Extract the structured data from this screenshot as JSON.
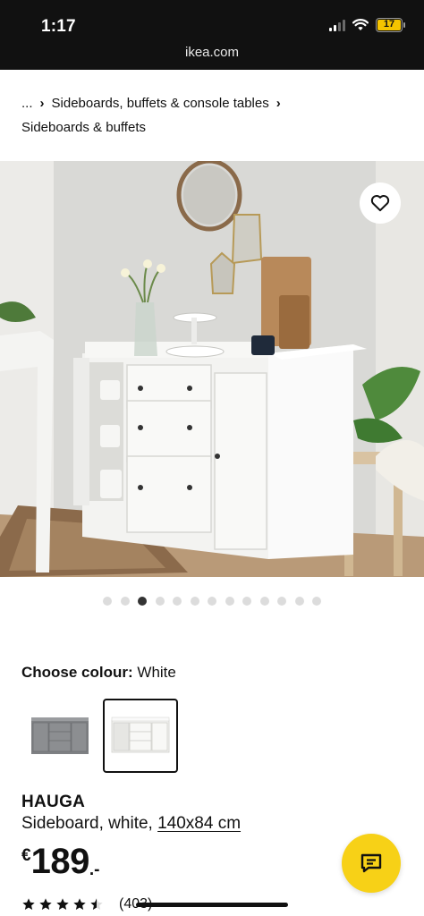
{
  "status_bar": {
    "time": "1:17",
    "battery_level": "17",
    "icons": [
      "signal-icon",
      "wifi-icon",
      "battery-icon"
    ]
  },
  "browser": {
    "url": "ikea.com"
  },
  "breadcrumb": {
    "ellipsis": "...",
    "category": "Sideboards, buffets & console tables",
    "subcategory": "Sideboards & buffets"
  },
  "gallery": {
    "image_count": 13,
    "active_index": 2,
    "favourite_icon": "heart-outline-icon"
  },
  "colour": {
    "label": "Choose colour:",
    "selected": "White",
    "options": [
      {
        "name": "Grey",
        "color": "#7f8184"
      },
      {
        "name": "White",
        "color": "#f2f2f0"
      }
    ]
  },
  "product": {
    "name": "HAUGA",
    "description": "Sideboard, white,",
    "dimensions": "140x84 cm",
    "currency": "€",
    "price": "189",
    "price_suffix": ".-",
    "rating": 4.5,
    "review_count": "(403)"
  },
  "chat": {
    "icon": "chat-bubble-icon",
    "color": "#f7d117"
  }
}
